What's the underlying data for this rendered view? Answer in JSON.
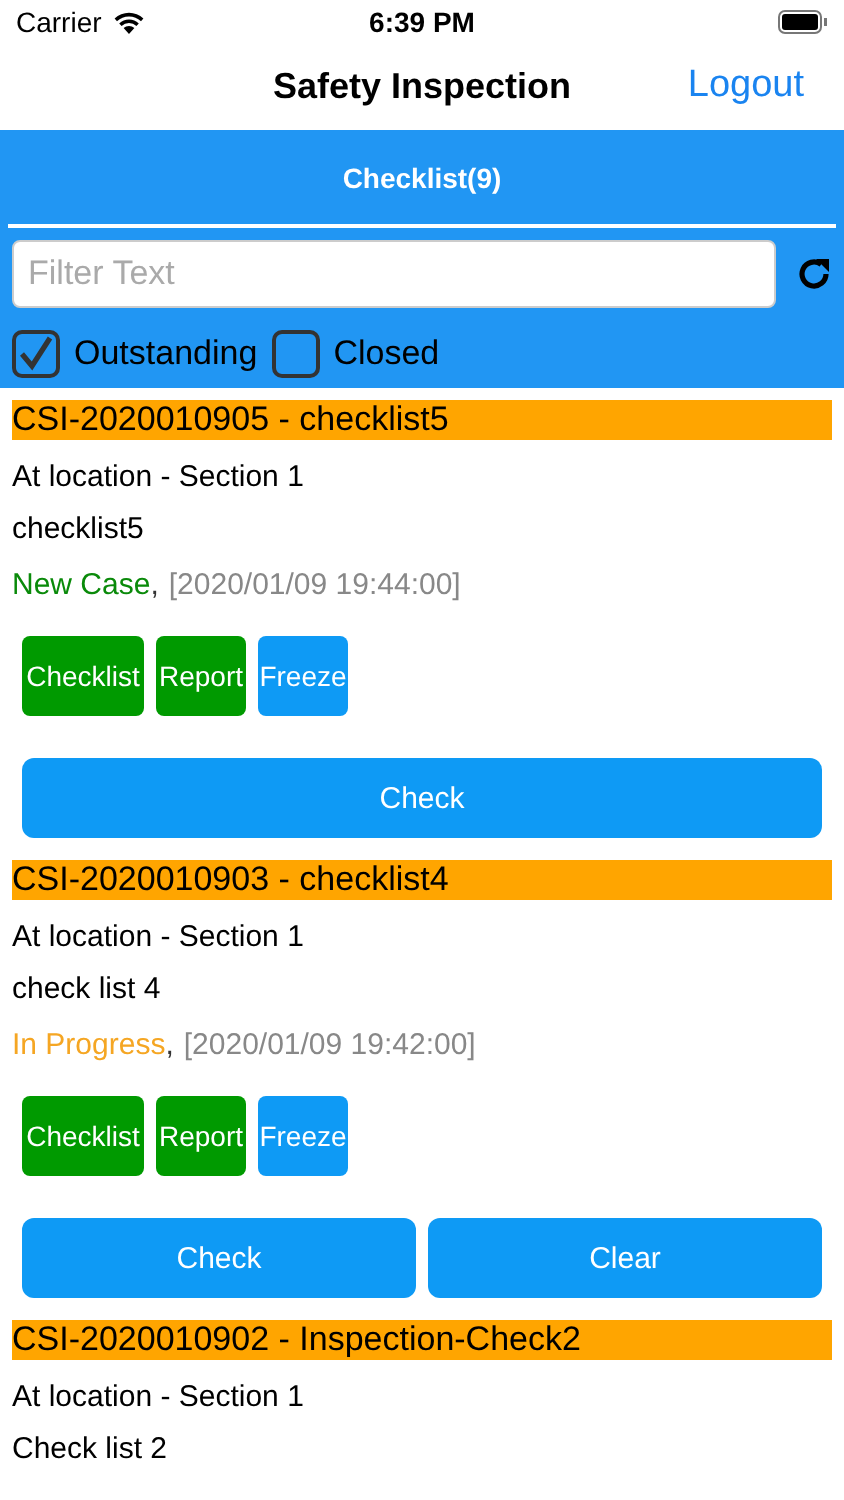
{
  "status_bar": {
    "carrier": "Carrier",
    "time": "6:39 PM"
  },
  "nav": {
    "title": "Safety Inspection",
    "action": "Logout"
  },
  "tabs": [
    {
      "label": "Checklist(9)",
      "selected": true
    }
  ],
  "filter": {
    "placeholder": "Filter Text"
  },
  "filters": [
    {
      "label": "Outstanding",
      "checked": true
    },
    {
      "label": "Closed",
      "checked": false
    }
  ],
  "cases": [
    {
      "header": "CSI-2020010905 - checklist5",
      "location": "At location - Section 1",
      "name": "checklist5",
      "status": "New Case",
      "color": "#0a8a0a",
      "separator": ",",
      "timestamp": "[2020/01/09 19:44:00]",
      "buttons": [
        {
          "label": "Checklist",
          "color": "#009a00"
        },
        {
          "label": "Report",
          "color": "#009a00"
        },
        {
          "label": "Freeze",
          "color": "#0e9af5"
        }
      ],
      "actions": [
        "Check"
      ]
    },
    {
      "header": "CSI-2020010903 - checklist4",
      "location": "At location - Section 1",
      "name": "check list 4",
      "status": "In Progress",
      "color": "#f5a623",
      "separator": ",",
      "timestamp": "[2020/01/09 19:42:00]",
      "buttons": [
        {
          "label": "Checklist",
          "color": "#009a00"
        },
        {
          "label": "Report",
          "color": "#009a00"
        },
        {
          "label": "Freeze",
          "color": "#0e9af5"
        }
      ],
      "actions": [
        "Check",
        "Clear"
      ]
    },
    {
      "header": "CSI-2020010902 - Inspection-Check2",
      "location": "At location - Section 1",
      "name": "Check list 2"
    }
  ]
}
